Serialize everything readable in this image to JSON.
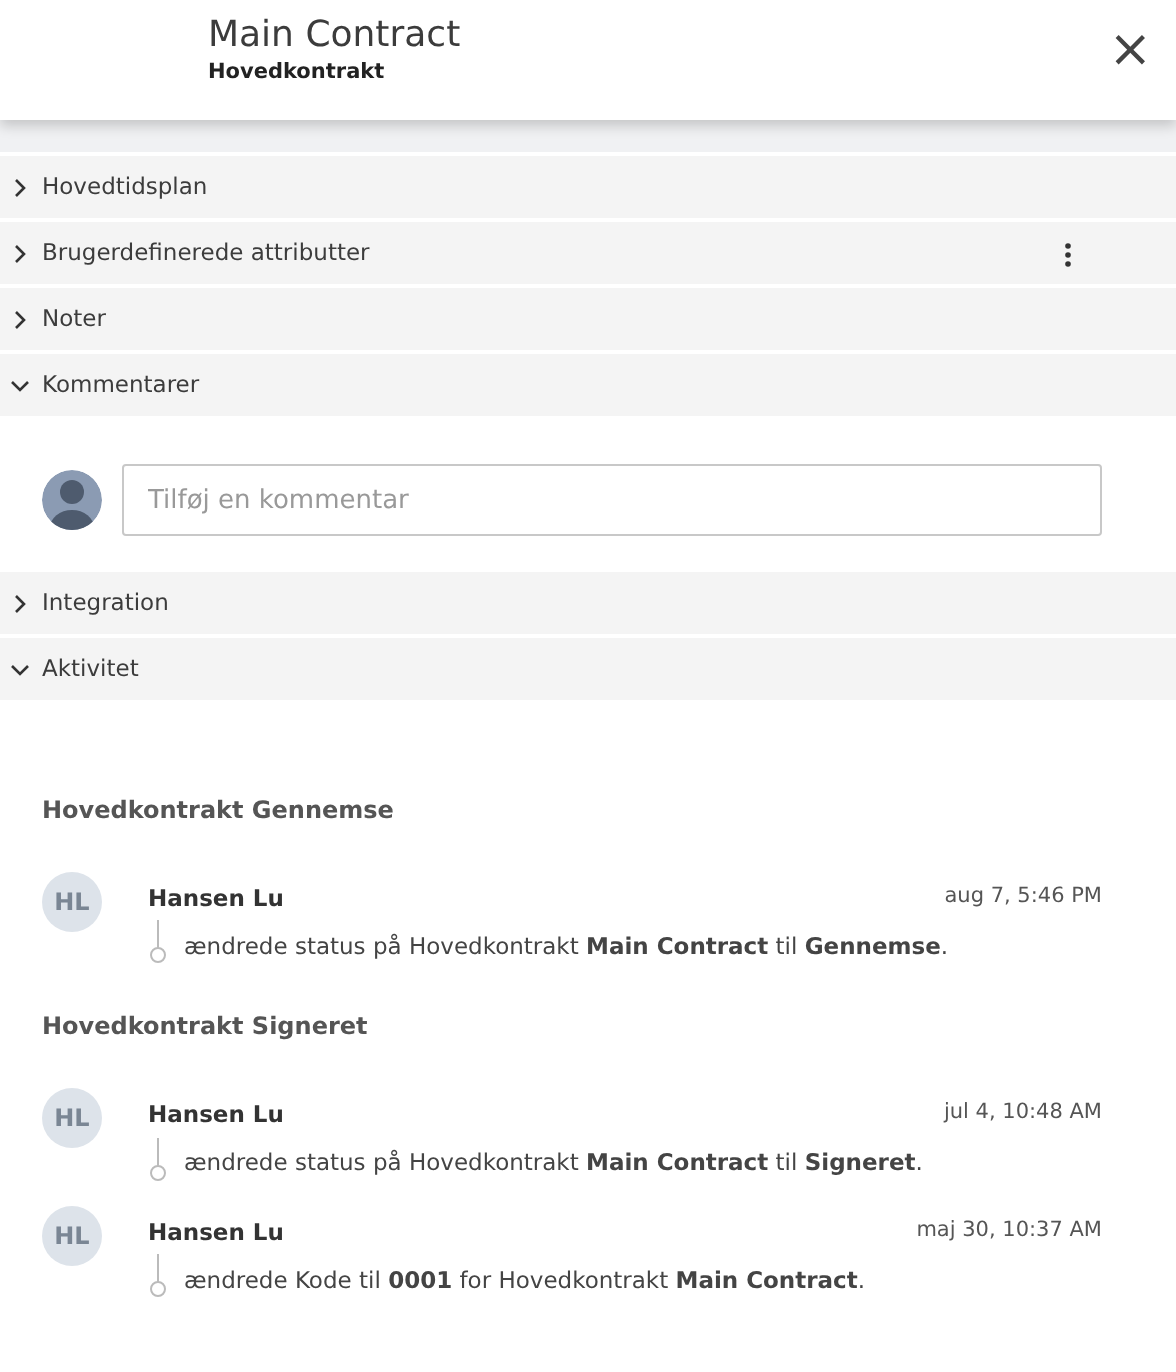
{
  "header": {
    "title": "Main Contract",
    "subtitle": "Hovedkontrakt",
    "close": "×"
  },
  "sections": [
    {
      "label": "Hovedtidsplan",
      "expanded": false,
      "menu": false,
      "kind": "plain"
    },
    {
      "label": "Brugerdefinerede attributter",
      "expanded": false,
      "menu": true,
      "kind": "plain"
    },
    {
      "label": "Noter",
      "expanded": false,
      "menu": false,
      "kind": "plain"
    },
    {
      "label": "Kommentarer",
      "expanded": true,
      "menu": false,
      "kind": "comments"
    },
    {
      "label": "Integration",
      "expanded": false,
      "menu": false,
      "kind": "plain"
    },
    {
      "label": "Aktivitet",
      "expanded": true,
      "menu": false,
      "kind": "activity"
    }
  ],
  "comment_input": {
    "placeholder": "Tilføj en kommentar"
  },
  "activity": [
    {
      "heading": "Hovedkontrakt Gennemse",
      "entries": [
        {
          "initials": "HL",
          "user": "Hansen Lu",
          "time": "aug 7, 5:46 PM",
          "text": "ændrede status på Hovedkontrakt **Main Contract** til **Gennemse**."
        }
      ]
    },
    {
      "heading": "Hovedkontrakt Signeret",
      "entries": [
        {
          "initials": "HL",
          "user": "Hansen Lu",
          "time": "jul 4, 10:48 AM",
          "text": "ændrede status på Hovedkontrakt **Main Contract** til **Signeret**."
        },
        {
          "initials": "HL",
          "user": "Hansen Lu",
          "time": "maj 30, 10:37 AM",
          "text": "ændrede Kode til **0001** for Hovedkontrakt **Main Contract**."
        }
      ]
    }
  ]
}
